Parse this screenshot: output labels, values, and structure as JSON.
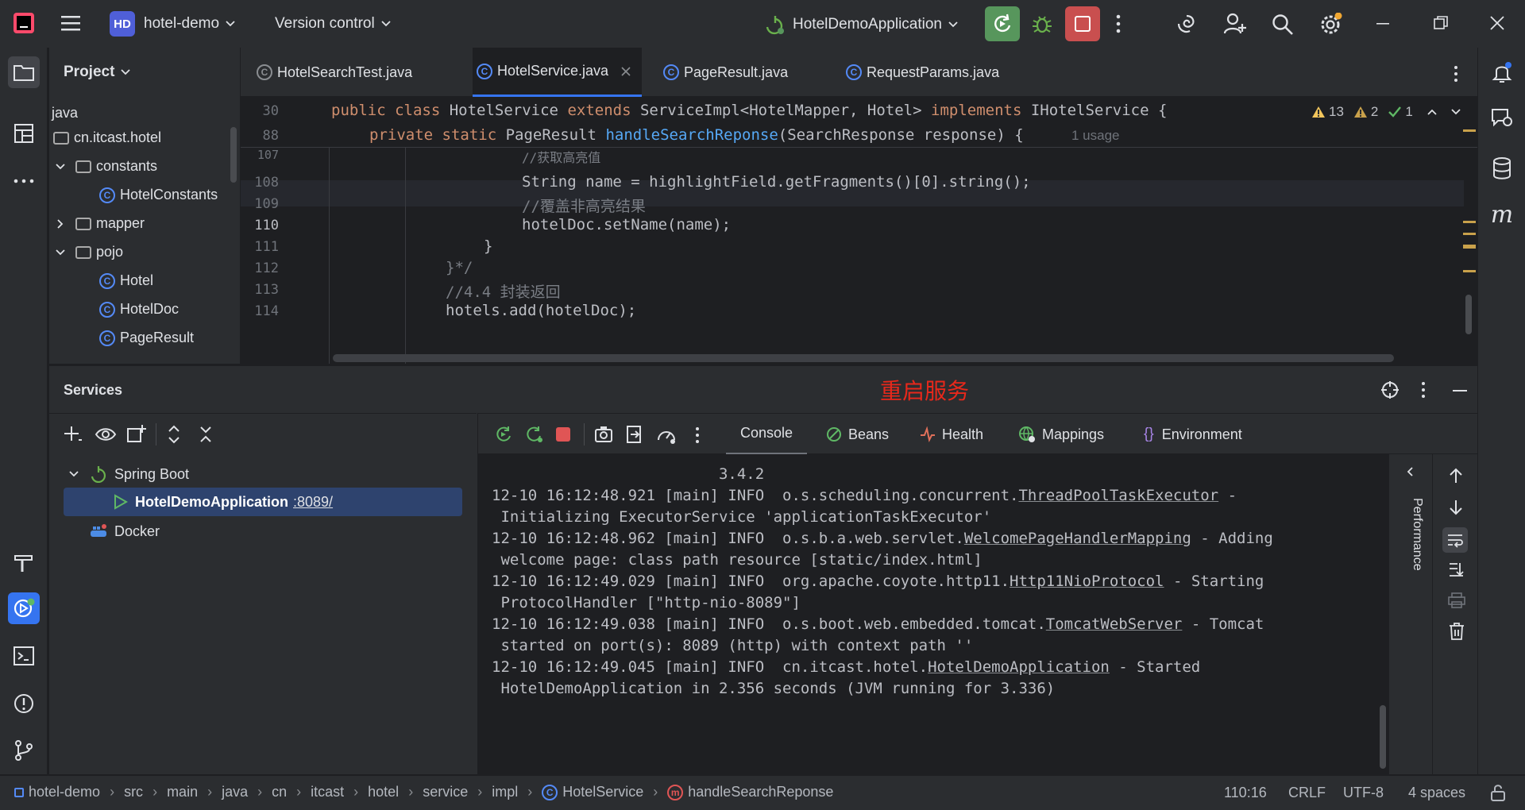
{
  "titlebar": {
    "project_badge": "HD",
    "project_name": "hotel-demo",
    "vcs": "Version control",
    "run_config": "HotelDemoApplication"
  },
  "project_panel": {
    "title": "Project",
    "items": [
      {
        "label": "java"
      },
      {
        "label": "cn.itcast.hotel"
      },
      {
        "label": "constants"
      },
      {
        "label": "HotelConstants"
      },
      {
        "label": "mapper"
      },
      {
        "label": "pojo"
      },
      {
        "label": "Hotel"
      },
      {
        "label": "HotelDoc"
      },
      {
        "label": "PageResult"
      }
    ]
  },
  "editor": {
    "tabs": [
      {
        "label": "HotelSearchTest.java"
      },
      {
        "label": "HotelService.java"
      },
      {
        "label": "PageResult.java"
      },
      {
        "label": "RequestParams.java"
      }
    ],
    "sticky": [
      {
        "line": "30",
        "text": "public class HotelService extends ServiceImpl<HotelMapper, Hotel> implements IHotelService {"
      },
      {
        "line": "88",
        "text": "private static PageResult handleSearchReponse(SearchResponse response) {",
        "hint": "1 usage"
      }
    ],
    "inspections": {
      "warnings": "13",
      "weak": "2",
      "ok": "1"
    },
    "lines": [
      {
        "num": "107",
        "text": "//获取高亮值"
      },
      {
        "num": "108",
        "text": "String name = highlightField.getFragments()[0].string();"
      },
      {
        "num": "109",
        "text": "//覆盖非高亮结果"
      },
      {
        "num": "110",
        "text": "hotelDoc.setName(name);"
      },
      {
        "num": "111",
        "text": "}"
      },
      {
        "num": "112",
        "text": "}*/"
      },
      {
        "num": "113",
        "text": "//4.4 封装返回"
      },
      {
        "num": "114",
        "text": "hotels.add(hotelDoc);"
      }
    ]
  },
  "services": {
    "title": "Services",
    "annotation": "重启服务",
    "tree": {
      "spring_boot": "Spring Boot",
      "app": "HotelDemoApplication",
      "port": ":8089/",
      "docker": "Docker"
    },
    "tabs": [
      "Console",
      "Beans",
      "Health",
      "Mappings",
      "Environment"
    ],
    "performance_label": "Performance",
    "console": [
      "                         3.4.2",
      "12-10 16:12:48.921 [main] INFO  o.s.scheduling.concurrent.ThreadPoolTaskExecutor -",
      " Initializing ExecutorService 'applicationTaskExecutor'",
      "12-10 16:12:48.962 [main] INFO  o.s.b.a.web.servlet.WelcomePageHandlerMapping - Adding",
      " welcome page: class path resource [static/index.html]",
      "12-10 16:12:49.029 [main] INFO  org.apache.coyote.http11.Http11NioProtocol - Starting",
      " ProtocolHandler [\"http-nio-8089\"]",
      "12-10 16:12:49.038 [main] INFO  o.s.boot.web.embedded.tomcat.TomcatWebServer - Tomcat",
      " started on port(s): 8089 (http) with context path ''",
      "12-10 16:12:49.045 [main] INFO  cn.itcast.hotel.HotelDemoApplication - Started",
      " HotelDemoApplication in 2.356 seconds (JVM running for 3.336)"
    ]
  },
  "statusbar": {
    "crumbs": [
      "hotel-demo",
      "src",
      "main",
      "java",
      "cn",
      "itcast",
      "hotel",
      "service",
      "impl",
      "HotelService",
      "handleSearchReponse"
    ],
    "position": "110:16",
    "line_sep": "CRLF",
    "encoding": "UTF-8",
    "indent": "4 spaces"
  }
}
